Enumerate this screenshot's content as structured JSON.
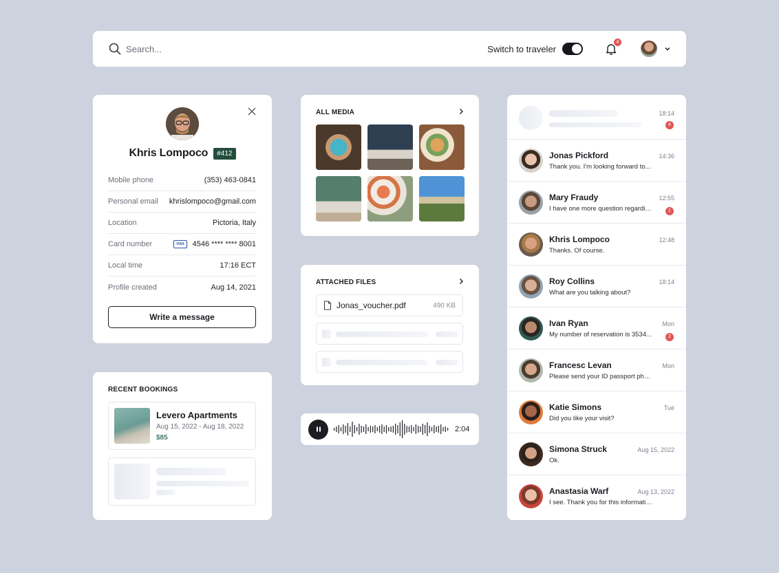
{
  "topbar": {
    "search_placeholder": "Search...",
    "switch_label": "Switch to traveler",
    "notification_count": "4",
    "icons": [
      "search-icon",
      "bell-icon",
      "chevron-down-icon"
    ]
  },
  "profile": {
    "name": "Khris Lompoco",
    "id_badge": "#412",
    "rows": [
      {
        "label": "Mobile phone",
        "value": "(353) 463-0841"
      },
      {
        "label": "Personal email",
        "value": "khrislompoco@gmail.com"
      },
      {
        "label": "Location",
        "value": "Pictoria, Italy"
      },
      {
        "label": "Card number",
        "value": "4546 **** **** 8001",
        "card_brand": "VISA"
      },
      {
        "label": "Local time",
        "value": "17:16 ECT"
      },
      {
        "label": "Profile created",
        "value": "Aug 14, 2021"
      }
    ],
    "write_button": "Write a message"
  },
  "bookings": {
    "title": "RECENT BOOKINGS",
    "items": [
      {
        "name": "Levero Apartments",
        "dates": "Aug 15, 2022 - Aug 18, 2022",
        "price": "$85"
      }
    ]
  },
  "media": {
    "title": "ALL MEDIA"
  },
  "files": {
    "title": "ATTACHED FILES",
    "items": [
      {
        "name": "Jonas_voucher.pdf",
        "size": "490 KB"
      }
    ]
  },
  "audio": {
    "duration": "2:04"
  },
  "chats": {
    "placeholder_time": "18:14",
    "placeholder_badge": "4",
    "items": [
      {
        "name": "Jonas Pickford",
        "message": "Thank you. I'm looking forward to...",
        "time": "14:36",
        "badge": ""
      },
      {
        "name": "Mary Fraudy",
        "message": "I have one more question regarding...",
        "time": "12:55",
        "badge": "1"
      },
      {
        "name": "Khris Lompoco",
        "message": "Thanks. Of course.",
        "time": "12:48",
        "badge": ""
      },
      {
        "name": "Roy Collins",
        "message": "What are you talking about?",
        "time": "18:14",
        "badge": ""
      },
      {
        "name": "Ivan Ryan",
        "message": "My number of reservation is 3534...",
        "time": "Mon",
        "badge": "2"
      },
      {
        "name": "Francesc Levan",
        "message": "Please send your ID passport photo as w...",
        "time": "Mon",
        "badge": ""
      },
      {
        "name": "Katie Simons",
        "message": "Did you like your visit?",
        "time": "Tue",
        "badge": ""
      },
      {
        "name": "Simona Struck",
        "message": "Ok.",
        "time": "Aug 15, 2022",
        "badge": ""
      },
      {
        "name": "Anastasia Warf",
        "message": "I see. Thank you for this information.",
        "time": "Aug 13, 2022",
        "badge": ""
      }
    ]
  },
  "colors": {
    "background": "#cdd3de",
    "accent_dark": "#234d3c",
    "badge_red": "#e05757",
    "price_green": "#3f7a6a"
  }
}
